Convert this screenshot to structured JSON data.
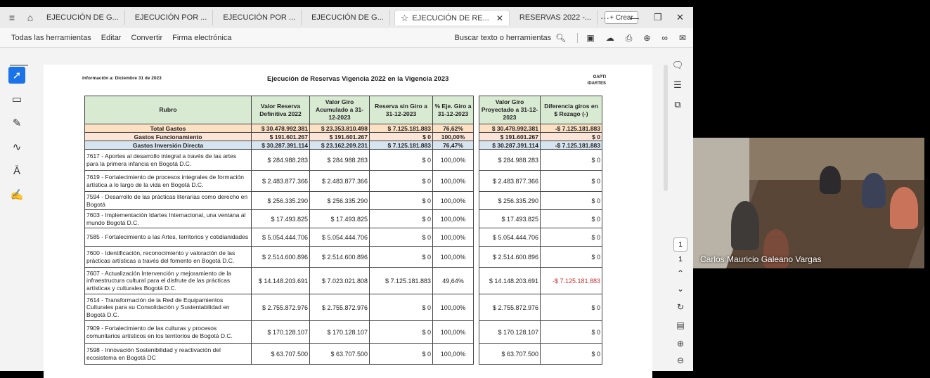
{
  "tabs": [
    {
      "label": "EJECUCIÓN DE G..."
    },
    {
      "label": "EJECUCIÓN POR ..."
    },
    {
      "label": "EJECUCIÓN POR ..."
    },
    {
      "label": "EJECUCIÓN DE G..."
    },
    {
      "label": "EJECUCIÓN DE RE..."
    },
    {
      "label": "RESERVAS 2022 -..."
    }
  ],
  "new_tab_label": "+ Crear",
  "toolbar": {
    "menus": [
      "Todas las herramientas",
      "Editar",
      "Convertir",
      "Firma electrónica"
    ],
    "search_label": "Buscar texto o herramientas"
  },
  "document": {
    "info_date": "Información a: Diciembre 31 de 2023",
    "title": "Ejecución de Reservas Vigencia 2022 en la Vigencia 2023",
    "org_line1": "OAPTI",
    "org_line2": "IDARTES"
  },
  "table": {
    "headers": [
      "Rubro",
      "Valor Reserva Definitiva 2022",
      "Valor Giro Acumulado a 31-12-2023",
      "Reserva sin Giro a 31-12-2023",
      "% Eje. Giro a 31-12-2023",
      "Valor Giro Proyectado a 31-12-2023",
      "Diferencia giros en $ Rezago (-)"
    ],
    "summary": [
      {
        "label": "Total Gastos",
        "c1": "$ 30.478.992.381",
        "c2": "$ 23.353.810.498",
        "c3": "$ 7.125.181.883",
        "c4": "76,62%",
        "c5": "$ 30.478.992.381",
        "c6": "-$ 7.125.181.883"
      },
      {
        "label": "Gastos Funcionamiento",
        "c1": "$ 191.601.267",
        "c2": "$ 191.601.267",
        "c3": "$ 0",
        "c4": "100,00%",
        "c5": "$ 191.601.267",
        "c6": "$ 0"
      },
      {
        "label": "Gastos Inversión Directa",
        "c1": "$ 30.287.391.114",
        "c2": "$ 23.162.209.231",
        "c3": "$ 7.125.181.883",
        "c4": "76,47%",
        "c5": "$ 30.287.391.114",
        "c6": "-$ 7.125.181.883"
      }
    ],
    "rows": [
      {
        "label": "7617 - Aportes al desarrollo integral a través de las artes para la primera infancia en Bogotá D.C.",
        "c1": "$ 284.988.283",
        "c2": "$ 284.988.283",
        "c3": "$ 0",
        "c4": "100,00%",
        "c5": "$ 284.988.283",
        "c6": "$ 0"
      },
      {
        "label": "7619 - Fortalecimiento de procesos integrales de formación artística a lo largo de la vida en Bogotá D.C.",
        "c1": "$ 2.483.877.366",
        "c2": "$ 2.483.877.366",
        "c3": "$ 0",
        "c4": "100,00%",
        "c5": "$ 2.483.877.366",
        "c6": "$ 0"
      },
      {
        "label": "7594 - Desarrollo de las prácticas literarias como derecho en Bogotá",
        "c1": "$ 256.335.290",
        "c2": "$ 256.335.290",
        "c3": "$ 0",
        "c4": "100,00%",
        "c5": "$ 256.335.290",
        "c6": "$ 0"
      },
      {
        "label": "7603 - Implementación Idartes Internacional, una ventana al mundo Bogotá D.C.",
        "c1": "$ 17.493.825",
        "c2": "$ 17.493.825",
        "c3": "$ 0",
        "c4": "100,00%",
        "c5": "$ 17.493.825",
        "c6": "$ 0"
      },
      {
        "label": "7585 - Fortalecimiento a las Artes, territorios y cotidianidades",
        "c1": "$ 5.054.444.706",
        "c2": "$ 5.054.444.706",
        "c3": "$ 0",
        "c4": "100,00%",
        "c5": "$ 5.054.444.706",
        "c6": "$ 0"
      },
      {
        "label": "7600 - Identificación, reconocimiento y valoración de las prácticas artísticas a través del fomento en Bogotá D.C.",
        "c1": "$ 2.514.600.896",
        "c2": "$ 2.514.600.896",
        "c3": "$ 0",
        "c4": "100,00%",
        "c5": "$ 2.514.600.896",
        "c6": "$ 0"
      },
      {
        "label": "7607 - Actualización Intervención y mejoramiento de la infraestructura cultural para el disfrute de las prácticas artísticas y culturales Bogotá D.C.",
        "c1": "$ 14.148.203.691",
        "c2": "$ 7.023.021.808",
        "c3": "$ 7.125.181.883",
        "c4": "49,64%",
        "c5": "$ 14.148.203.691",
        "c6": "-$ 7.125.181.883"
      },
      {
        "label": "7614 - Transformación de la Red de Equipamientos Culturales para su Consolidación y Sustentabilidad en Bogotá D.C.",
        "c1": "$ 2.755.872.976",
        "c2": "$ 2.755.872.976",
        "c3": "$ 0",
        "c4": "100,00%",
        "c5": "$ 2.755.872.976",
        "c6": "$ 0"
      },
      {
        "label": "7909 - Fortalecimiento de las culturas y procesos comunitarios artísticos en los territorios de Bogotá D.C.",
        "c1": "$ 170.128.107",
        "c2": "$ 170.128.107",
        "c3": "$ 0",
        "c4": "100,00%",
        "c5": "$ 170.128.107",
        "c6": "$ 0"
      },
      {
        "label": "7598 - Innovación Sostenibilidad y reactivación del ecosistema en Bogotá DC",
        "c1": "$ 63.707.500",
        "c2": "$ 63.707.500",
        "c3": "$ 0",
        "c4": "100,00%",
        "c5": "$ 63.707.500",
        "c6": "$ 0"
      }
    ]
  },
  "pagination": {
    "current": "1",
    "total": "1"
  },
  "video": {
    "participant_name": "Carlos Mauricio Galeano Vargas"
  },
  "colors": {
    "selected_tool": "#1a73e8",
    "negative": "#d32f2f",
    "header_green": "#d9ead3"
  }
}
